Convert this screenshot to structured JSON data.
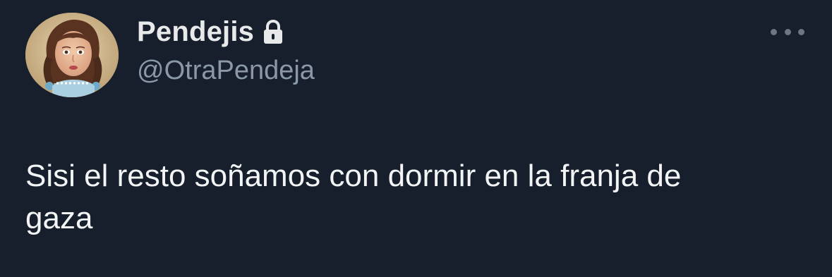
{
  "tweet": {
    "author": {
      "display_name": "Pendejis",
      "handle": "@OtraPendeja",
      "protected_icon": "lock-icon",
      "avatar_icon": "profile-photo"
    },
    "more_options_icon": "more-horizontal-icon",
    "text": "Sisi el resto soñamos con dormir en la franja de\ngaza"
  },
  "colors": {
    "background": "#161f2b",
    "primary_text": "#e7e9ea",
    "secondary_text": "#8b98a5"
  }
}
